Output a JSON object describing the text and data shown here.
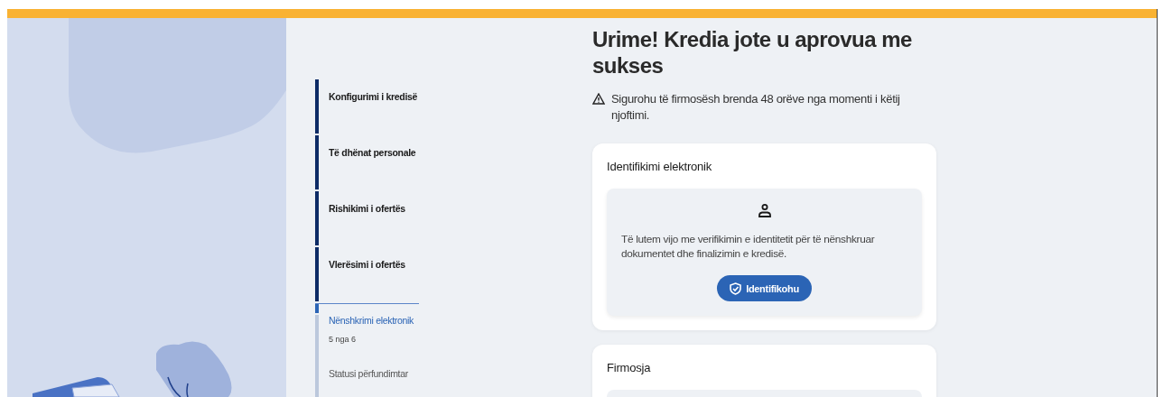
{
  "steps": [
    {
      "label": "Konfigurimi i kredisë",
      "completed": true,
      "selected": false
    },
    {
      "label": "Të dhënat personale",
      "completed": true,
      "selected": false
    },
    {
      "label": "Rishikimi i ofertës",
      "completed": true,
      "selected": false
    },
    {
      "label": "Vlerësimi i ofertës",
      "completed": true,
      "selected": false
    },
    {
      "label": "Nënshkrimi elektronik",
      "completed": false,
      "selected": true,
      "progress": "5 nga 6"
    },
    {
      "label": "Statusi përfundimtar",
      "completed": false,
      "selected": false
    }
  ],
  "title": "Urime! Kredia jote u aprovua me sukses",
  "warning": "Sigurohu të firmosësh brenda 48 orëve nga momenti i këtij njoftimi.",
  "cards": [
    {
      "title": "Identifikimi elektronik",
      "message": "Të lutem vijo me verifikimin e identitetit për të nënshkruar dokumentet dhe finalizimin e kredisë.",
      "button": "Identifikohu"
    },
    {
      "title": "Firmosja"
    }
  ]
}
